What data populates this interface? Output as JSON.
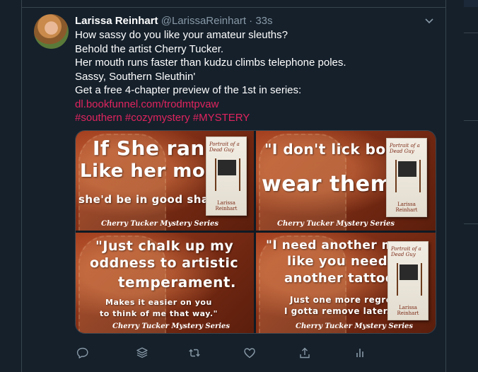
{
  "tweet": {
    "author_name": "Larissa Reinhart",
    "handle": "@LarissaReinhart",
    "separator": "·",
    "time": "33s",
    "lines": [
      "How sassy do you like your amateur sleuths?",
      "Behold the artist Cherry Tucker.",
      "Her mouth runs faster than kudzu climbs telephone poles.",
      "Sassy, Southern Sleuthin'",
      "Get a free 4-chapter preview of the 1st in series:"
    ],
    "link": "dl.bookfunnel.com/trodmtpvaw",
    "hashtags": "#southern  #cozymystery #MYSTERY"
  },
  "media": {
    "tiles": [
      {
        "lines": [
          "If She ran",
          "Like her mouth",
          "she'd be in good shape."
        ],
        "series": "Cherry Tucker Mystery Series",
        "book_title": "Portrait of a Dead Guy",
        "book_author": "Larissa Reinhart"
      },
      {
        "lines": [
          "\"I don't lick boots.",
          "wear them.\""
        ],
        "series": "Cherry Tucker Mystery Series",
        "book_title": "Portrait of a Dead Guy",
        "book_author": "Larissa Reinhart"
      },
      {
        "lines": [
          "\"Just chalk up my",
          "oddness to artistic",
          "temperament.",
          "Makes it easier on you",
          "to think of me that way.\""
        ],
        "series": "Cherry Tucker Mystery Series",
        "book_title": "",
        "book_author": ""
      },
      {
        "lines": [
          "\"I need another man",
          "like you need",
          "another tattoo",
          "Just one more regret",
          "I gotta remove later.\""
        ],
        "series": "Cherry Tucker Mystery Series",
        "book_title": "Portrait of a Dead Guy",
        "book_author": "Larissa Reinhart"
      }
    ]
  },
  "icons": [
    "caret-down-icon",
    "reply-icon",
    "stack-icon",
    "retweet-icon",
    "like-icon",
    "share-icon",
    "analytics-icon"
  ],
  "colors": {
    "background": "#15202b",
    "text": "#ffffff",
    "muted": "#8899a6",
    "link": "#e0245e",
    "border": "#38444d"
  }
}
